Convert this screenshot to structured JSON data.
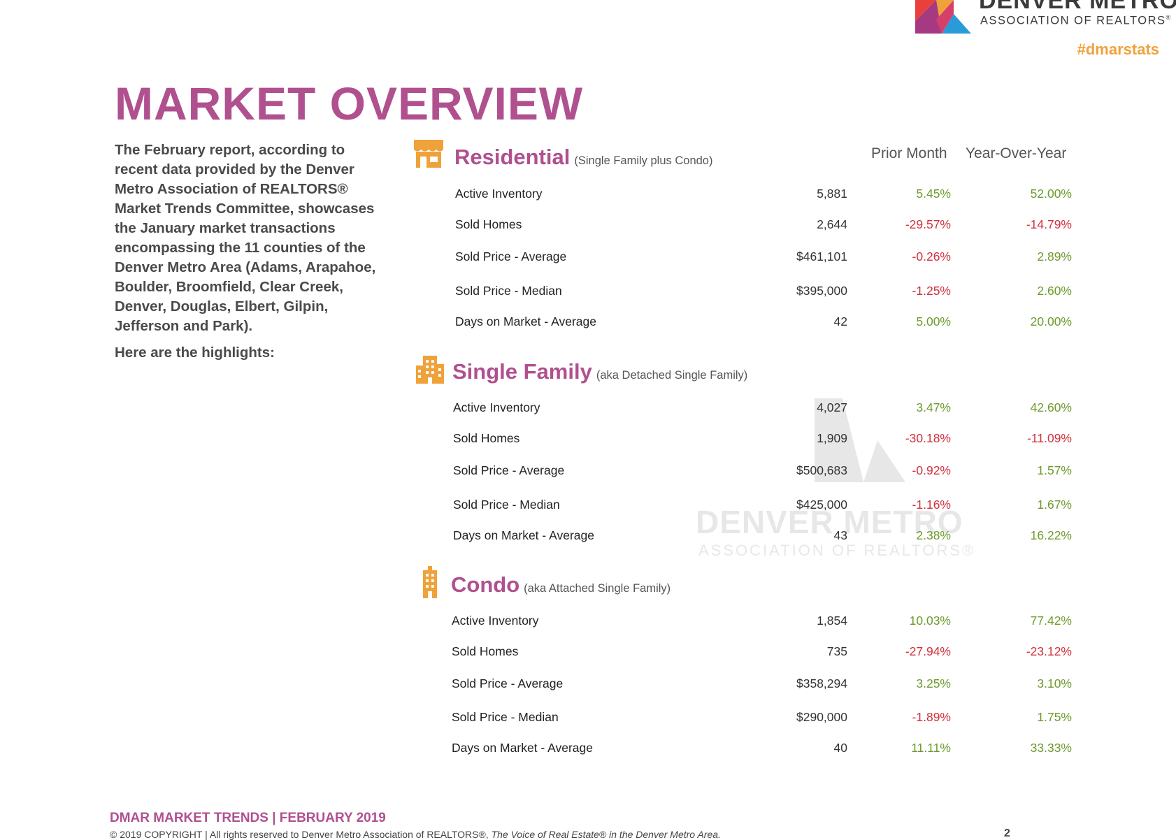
{
  "brand": {
    "name": "DENVER METRO",
    "subtitle": "ASSOCIATION OF REALTORS",
    "registered": "®",
    "hashtag": "#dmarstats"
  },
  "title": "MARKET OVERVIEW",
  "intro": {
    "paragraph": "The February report, according to recent data provided by the Denver Metro Association of REALTORS® Market Trends Committee, showcases the January market transactions encompassing the 11 counties of the Denver Metro Area (Adams, Arapahoe, Boulder, Broomfield, Clear Creek, Denver, Douglas, Elbert, Gilpin, Jefferson and Park).",
    "highlights": "Here are the highlights:"
  },
  "columns": {
    "prior_month": "Prior Month",
    "year_over_year": "Year-Over-Year"
  },
  "sections": [
    {
      "name": "Residential",
      "subtitle": "(Single Family plus Condo)",
      "icon": "storefront-icon",
      "rows": [
        {
          "label": "Active Inventory",
          "value": "5,881",
          "prior_month": "5.45%",
          "yoy": "52.00%"
        },
        {
          "label": "Sold Homes",
          "value": "2,644",
          "prior_month": "-29.57%",
          "yoy": "-14.79%"
        },
        {
          "label": "Sold Price - Average",
          "value": "$461,101",
          "prior_month": "-0.26%",
          "yoy": "2.89%"
        },
        {
          "label": "Sold Price - Median",
          "value": "$395,000",
          "prior_month": "-1.25%",
          "yoy": "2.60%"
        },
        {
          "label": "Days on Market - Average",
          "value": "42",
          "prior_month": "5.00%",
          "yoy": "20.00%"
        }
      ]
    },
    {
      "name": "Single Family",
      "subtitle": "(aka Detached Single Family)",
      "icon": "buildings-icon",
      "rows": [
        {
          "label": "Active Inventory",
          "value": "4,027",
          "prior_month": "3.47%",
          "yoy": "42.60%"
        },
        {
          "label": "Sold Homes",
          "value": "1,909",
          "prior_month": "-30.18%",
          "yoy": "-11.09%"
        },
        {
          "label": "Sold Price - Average",
          "value": "$500,683",
          "prior_month": "-0.92%",
          "yoy": "1.57%"
        },
        {
          "label": "Sold Price - Median",
          "value": "$425,000",
          "prior_month": "-1.16%",
          "yoy": "1.67%"
        },
        {
          "label": "Days on Market - Average",
          "value": "43",
          "prior_month": "2.38%",
          "yoy": "16.22%"
        }
      ]
    },
    {
      "name": "Condo",
      "subtitle": "(aka Attached Single Family)",
      "icon": "tower-icon",
      "rows": [
        {
          "label": "Active Inventory",
          "value": "1,854",
          "prior_month": "10.03%",
          "yoy": "77.42%"
        },
        {
          "label": "Sold Homes",
          "value": "735",
          "prior_month": "-27.94%",
          "yoy": "-23.12%"
        },
        {
          "label": "Sold Price - Average",
          "value": "$358,294",
          "prior_month": "3.25%",
          "yoy": "3.10%"
        },
        {
          "label": "Sold Price - Median",
          "value": "$290,000",
          "prior_month": "-1.89%",
          "yoy": "1.75%"
        },
        {
          "label": "Days on Market - Average",
          "value": "40",
          "prior_month": "11.11%",
          "yoy": "33.33%"
        }
      ]
    }
  ],
  "watermark": {
    "name": "DENVER METRO",
    "subtitle": "ASSOCIATION OF REALTORS®"
  },
  "footer": {
    "title": "DMAR MARKET TRENDS | FEBRUARY 2019",
    "copyright": "© 2019 COPYRIGHT | All rights reserved to Denver Metro Association of REALTORS®,",
    "tagline": "The Voice of Real Estate® in the Denver Metro Area.",
    "page_number": "2"
  },
  "colors": {
    "accent": "#b0508f",
    "positive": "#6e9a2c",
    "negative": "#d0303c",
    "icon": "#f0a23a"
  }
}
